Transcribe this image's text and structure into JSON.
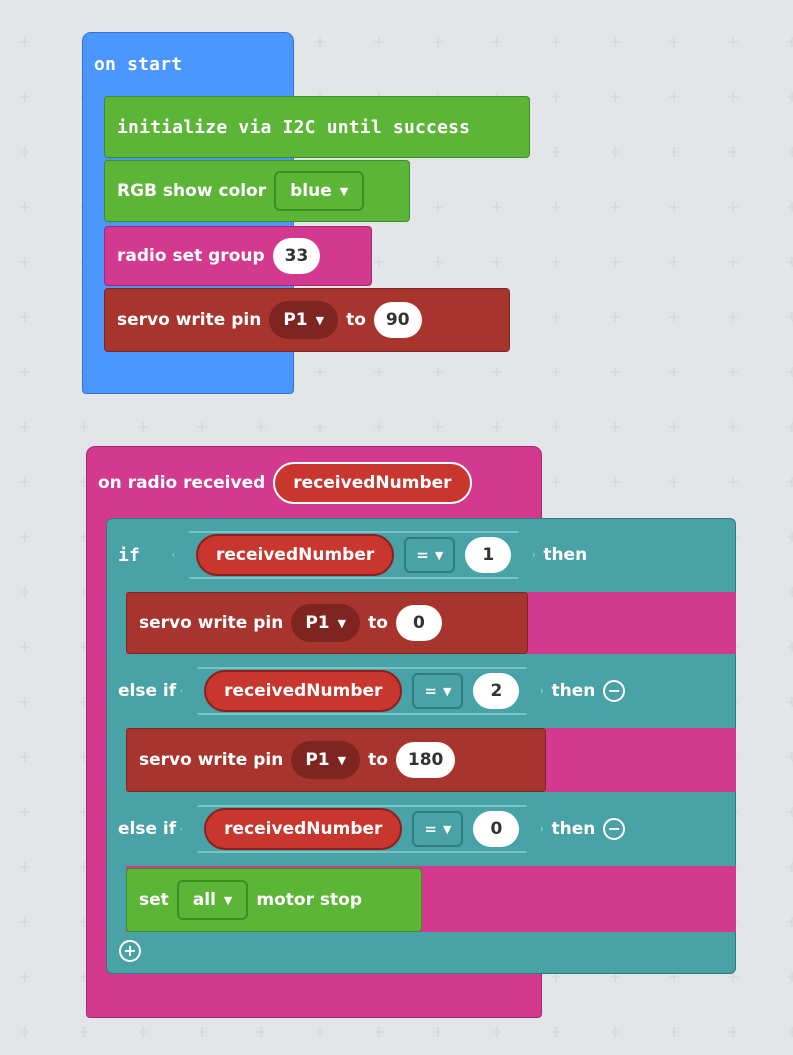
{
  "colors": {
    "workspace_bg": "#ecf0f1",
    "basic_blue": "#4c97ff",
    "green": "#5cb537",
    "radio_pink": "#d2398f",
    "servo_red": "#a8352d",
    "logic_teal": "#48a2a6",
    "variable_red": "#c8362e"
  },
  "on_start": {
    "label": "on start",
    "initialize": {
      "label": "initialize via I2C until success"
    },
    "rgb": {
      "label": "RGB show color",
      "color_value": "blue"
    },
    "radio_group": {
      "label": "radio set group",
      "value": "33"
    },
    "servo": {
      "label": "servo write pin",
      "pin": "P1",
      "to_label": "to",
      "value": "90"
    }
  },
  "on_radio": {
    "label": "on radio received",
    "param": "receivedNumber",
    "if_block": {
      "if_label": "if",
      "then_label": "then",
      "else_if_label": "else if",
      "branches": [
        {
          "variable": "receivedNumber",
          "operator": "=",
          "value": "1",
          "action": {
            "label": "servo write pin",
            "pin": "P1",
            "to_label": "to",
            "value": "0"
          }
        },
        {
          "variable": "receivedNumber",
          "operator": "=",
          "value": "2",
          "action": {
            "label": "servo write pin",
            "pin": "P1",
            "to_label": "to",
            "value": "180"
          }
        },
        {
          "variable": "receivedNumber",
          "operator": "=",
          "value": "0",
          "action": {
            "set_label": "set",
            "motor": "all",
            "stop_label": "motor stop"
          }
        }
      ]
    }
  },
  "icons": [
    "dropdown-caret-icon",
    "minus-circle-icon",
    "plus-circle-icon",
    "grid-plus-icon"
  ]
}
